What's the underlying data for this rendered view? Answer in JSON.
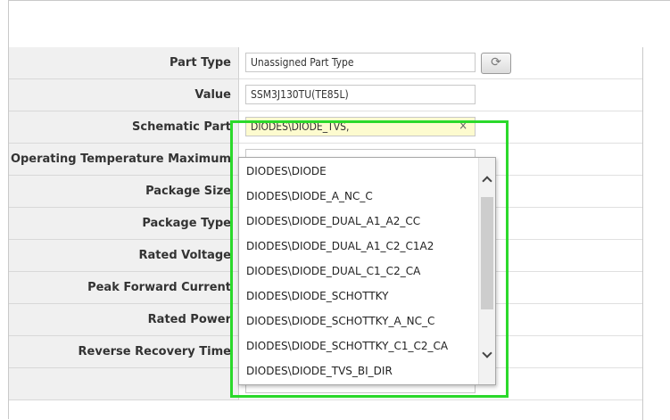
{
  "form": {
    "rows": [
      {
        "label": "Part Type",
        "value": "Unassigned Part Type"
      },
      {
        "label": "Value",
        "value": "SSM3J130TU(TE85L)"
      },
      {
        "label": "Schematic Part",
        "value": "DIODES\\DIODE_TVS,",
        "clear_symbol": "×"
      },
      {
        "label": "Operating Temperature Maximum",
        "value": ""
      },
      {
        "label": "Package Size",
        "value": ""
      },
      {
        "label": "Package Type",
        "value": ""
      },
      {
        "label": "Rated Voltage",
        "value": ""
      },
      {
        "label": "Peak Forward Current",
        "value": ""
      },
      {
        "label": "Rated Power",
        "value": ""
      },
      {
        "label": "Reverse Recovery Time",
        "value": ""
      }
    ],
    "refresh_icon": "refresh-icon",
    "refresh_symbol": "⟳"
  },
  "dropdown": {
    "options": [
      "DIODES\\DIODE",
      "DIODES\\DIODE_A_NC_C",
      "DIODES\\DIODE_DUAL_A1_A2_CC",
      "DIODES\\DIODE_DUAL_A1_C2_C1A2",
      "DIODES\\DIODE_DUAL_C1_C2_CA",
      "DIODES\\DIODE_SCHOTTKY",
      "DIODES\\DIODE_SCHOTTKY_A_NC_C",
      "DIODES\\DIODE_SCHOTTKY_C1_C2_CA",
      "DIODES\\DIODE_TVS_BI_DIR"
    ],
    "scroll_up_icon": "chevron-up-icon",
    "scroll_down_icon": "chevron-down-icon"
  },
  "colors": {
    "highlight": "#2bd92b",
    "selected_field": "#fdfbcf",
    "label_bg": "#f0f0f0"
  }
}
